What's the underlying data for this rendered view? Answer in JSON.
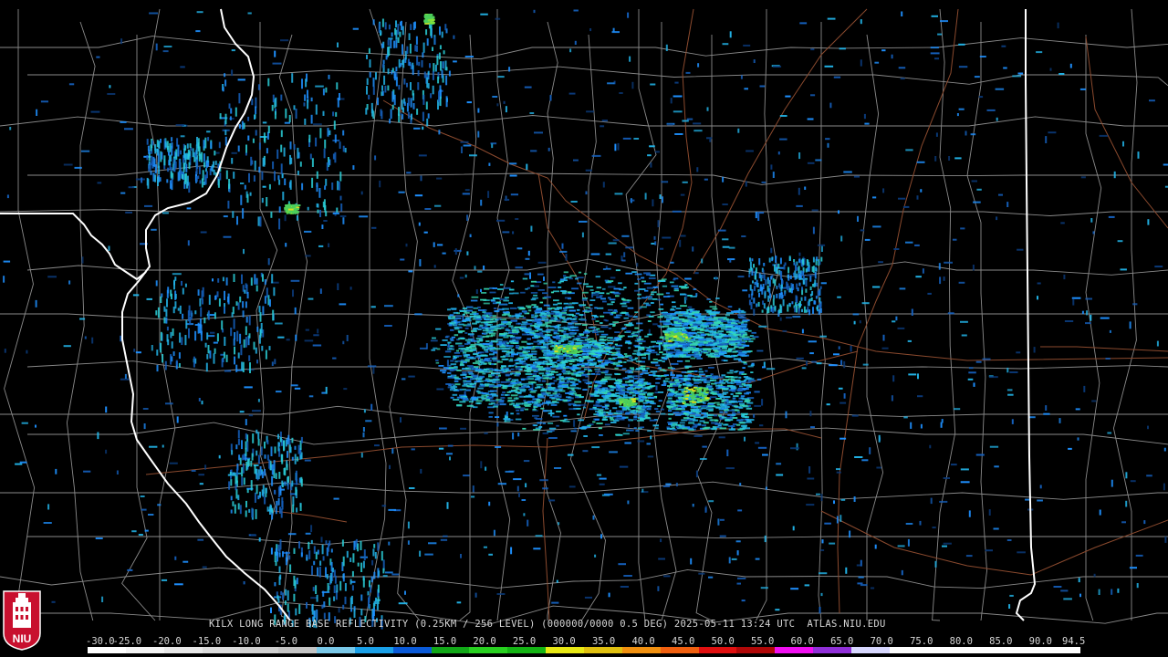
{
  "caption": "KILX LONG RANGE BASE REFLECTIVITY (0.25KM / 256 LEVEL) (000000/0000 0.5 DEG) 2025-05-11 13:24 UTC  ATLAS.NIU.EDU",
  "logo": {
    "text": "NIU",
    "colors": {
      "shield": "#c8102e",
      "tower": "#ffffff",
      "border": "#ffffff"
    }
  },
  "colors": {
    "background": "#000000",
    "county_lines": "#8a8a8a",
    "state_lines": "#ffffff",
    "roads": "#8b4a2e",
    "echo_palette": [
      "#0a3a7a",
      "#1560bd",
      "#1e90ff",
      "#22b4e8",
      "#2ad0d8",
      "#36d8b0",
      "#4ccf5a",
      "#7ee03a",
      "#d8e020"
    ]
  },
  "scale": {
    "labels": [
      "-30.0",
      "-25.0",
      "-20.0",
      "-15.0",
      "-10.0",
      "-5.0",
      "0.0",
      "5.0",
      "10.0",
      "15.0",
      "20.0",
      "25.0",
      "30.0",
      "35.0",
      "40.0",
      "45.0",
      "50.0",
      "55.0",
      "60.0",
      "65.0",
      "70.0",
      "75.0",
      "80.0",
      "85.0",
      "90.0",
      "94.5"
    ],
    "colors": [
      "#ffffff",
      "#f4f4f4",
      "#e8e8e8",
      "#dcdcdc",
      "#d0d0d0",
      "#c4c4c4",
      "#7ac8e8",
      "#1aa0e8",
      "#0a5ad8",
      "#12a818",
      "#28d020",
      "#14b414",
      "#e8e814",
      "#e0c010",
      "#f09010",
      "#f06010",
      "#e01010",
      "#b00808",
      "#f010f0",
      "#9030d8",
      "#d8d8ff",
      "#ffffff",
      "#ffffff",
      "#ffffff",
      "#ffffff",
      "#ffffff"
    ]
  }
}
